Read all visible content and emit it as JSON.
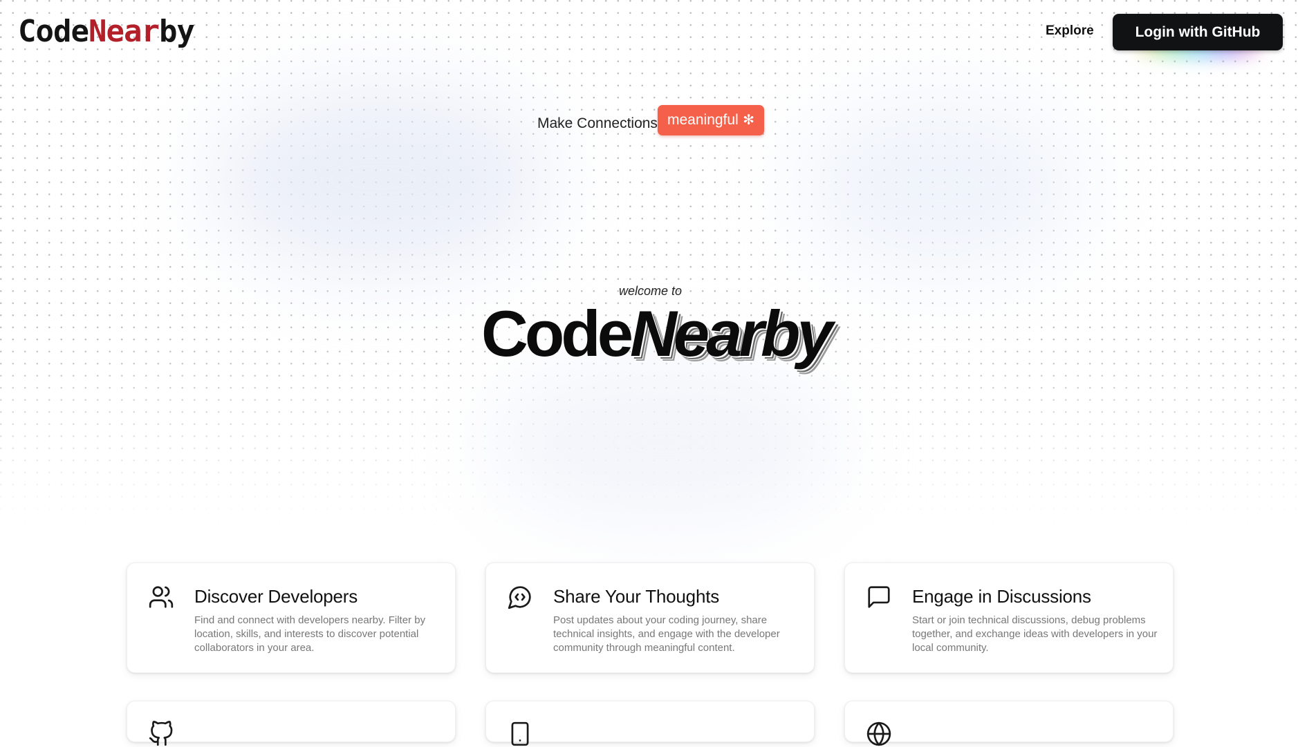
{
  "header": {
    "logo_prefix": "Code",
    "logo_accent": "Near",
    "logo_suffix": "by",
    "nav_explore": "Explore",
    "login_button": "Login with GitHub"
  },
  "tagline": {
    "text": "Make Connections",
    "badge": "meaningful",
    "badge_icon": "✻"
  },
  "hero": {
    "welcome": "welcome to",
    "title_plain": "Code",
    "title_italic": "Nearby"
  },
  "features": [
    {
      "icon": "users-icon",
      "title": "Discover Developers",
      "description": "Find and connect with developers nearby. Filter by location, skills, and interests to discover potential collaborators in your area."
    },
    {
      "icon": "code-chat-icon",
      "title": "Share Your Thoughts",
      "description": "Post updates about your coding journey, share technical insights, and engage with the developer community through meaningful content."
    },
    {
      "icon": "message-square-icon",
      "title": "Engage in Discussions",
      "description": "Start or join technical discussions, debug problems together, and exchange ideas with developers in your local community."
    }
  ],
  "features_row2_icons": [
    "github-icon",
    "mobile-icon",
    "globe-icon"
  ],
  "colors": {
    "brand_accent": "#b4202a",
    "badge_bg": "#f4604a",
    "button_bg": "#111214"
  }
}
